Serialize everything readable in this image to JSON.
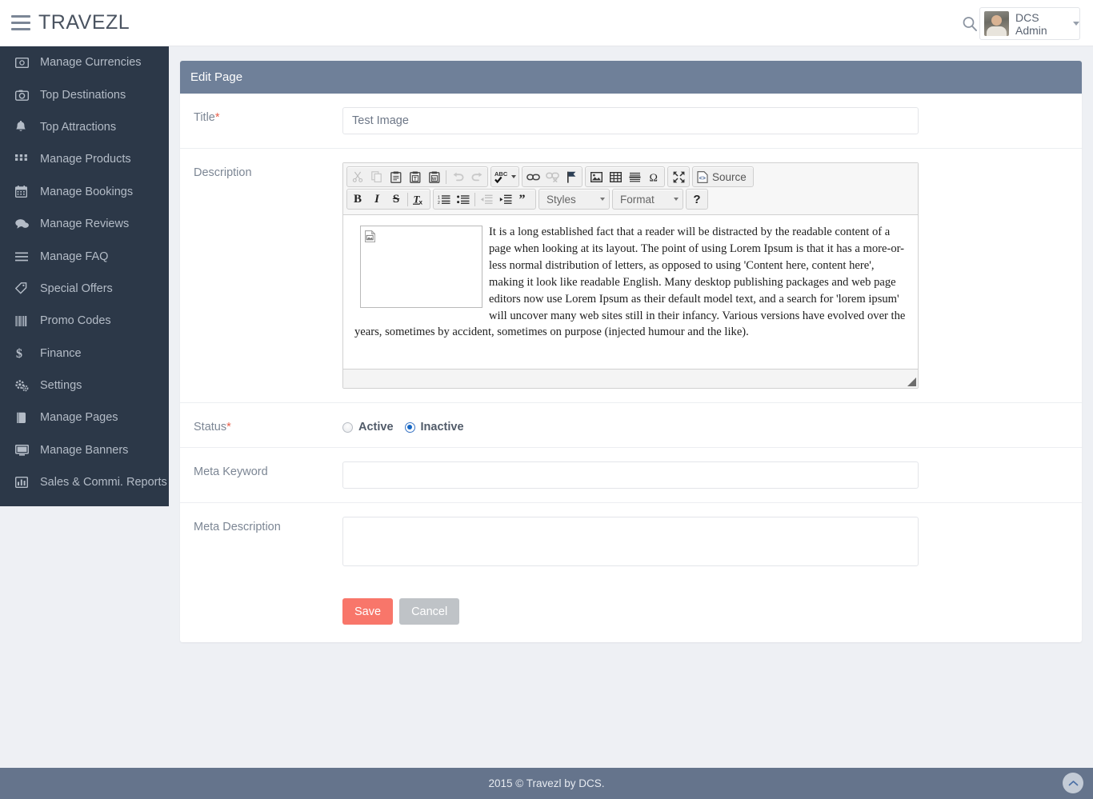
{
  "header": {
    "brand": "TRAVEZL",
    "menu_icon": "hamburger-icon",
    "search_icon": "search-icon",
    "user_name": "DCS Admin"
  },
  "sidebar": {
    "items": [
      {
        "label": "Manage Currencies",
        "icon": "money-icon"
      },
      {
        "label": "Top Destinations",
        "icon": "camera-icon"
      },
      {
        "label": "Top Attractions",
        "icon": "bell-icon"
      },
      {
        "label": "Manage Products",
        "icon": "grid-icon"
      },
      {
        "label": "Manage Bookings",
        "icon": "calendar-icon"
      },
      {
        "label": "Manage Reviews",
        "icon": "comments-icon"
      },
      {
        "label": "Manage FAQ",
        "icon": "list-icon"
      },
      {
        "label": "Special Offers",
        "icon": "tags-icon"
      },
      {
        "label": "Promo Codes",
        "icon": "barcode-icon"
      },
      {
        "label": "Finance",
        "icon": "dollar-icon"
      },
      {
        "label": "Settings",
        "icon": "gears-icon"
      },
      {
        "label": "Manage Pages",
        "icon": "book-icon"
      },
      {
        "label": "Manage Banners",
        "icon": "desktop-icon"
      },
      {
        "label": "Sales & Commi. Reports",
        "icon": "bar-chart-icon"
      }
    ]
  },
  "panel": {
    "title": "Edit Page",
    "fields": {
      "title_label": "Title",
      "title_required": "*",
      "title_value": "Test Image",
      "description_label": "Description",
      "status_label": "Status",
      "status_required": "*",
      "status_active": "Active",
      "status_inactive": "Inactive",
      "status_selected": "Inactive",
      "meta_keyword_label": "Meta Keyword",
      "meta_keyword_value": "",
      "meta_description_label": "Meta Description",
      "meta_description_value": ""
    },
    "buttons": {
      "save": "Save",
      "cancel": "Cancel"
    }
  },
  "editor": {
    "toolbar": {
      "group1": [
        "cut-icon",
        "copy-icon",
        "paste-icon",
        "paste-text-icon",
        "paste-word-icon",
        "undo-icon",
        "redo-icon"
      ],
      "group2": [
        "spellcheck-icon"
      ],
      "group3": [
        "link-icon",
        "unlink-icon",
        "anchor-icon"
      ],
      "group4": [
        "image-icon",
        "table-icon",
        "horizontal-rule-icon",
        "special-char-icon"
      ],
      "group5": [
        "maximize-icon"
      ],
      "source_label": "Source",
      "group6": [
        "bold-icon",
        "italic-icon",
        "strikethrough-icon",
        "remove-format-icon"
      ],
      "group7": [
        "numbered-list-icon",
        "bulleted-list-icon",
        "outdent-icon",
        "indent-icon",
        "blockquote-icon"
      ],
      "styles_label": "Styles",
      "format_label": "Format",
      "help_label": "?"
    },
    "content": "It is a long established fact that a reader will be distracted by the readable content of a page when looking at its layout. The point of using Lorem Ipsum is that it has a more-or-less normal distribution of letters, as opposed to using 'Content here, content here', making it look like readable English. Many desktop publishing packages and web page editors now use Lorem Ipsum as their default model text, and a search for 'lorem ipsum' will uncover many web sites still in their infancy. Various versions have evolved over the years, sometimes by accident, sometimes on purpose (injected humour and the like).",
    "image_placeholder": "broken-image-icon"
  },
  "footer": {
    "text": "2015 © Travezl by DCS.",
    "scroll_top_icon": "chevron-up-icon"
  },
  "colors": {
    "sidebar": "#2c3848",
    "panel_header": "#6f8099",
    "save_button": "#f8766a",
    "cancel_button": "#bfc3c7",
    "footer": "#65748c",
    "required_star": "#e8604c"
  }
}
